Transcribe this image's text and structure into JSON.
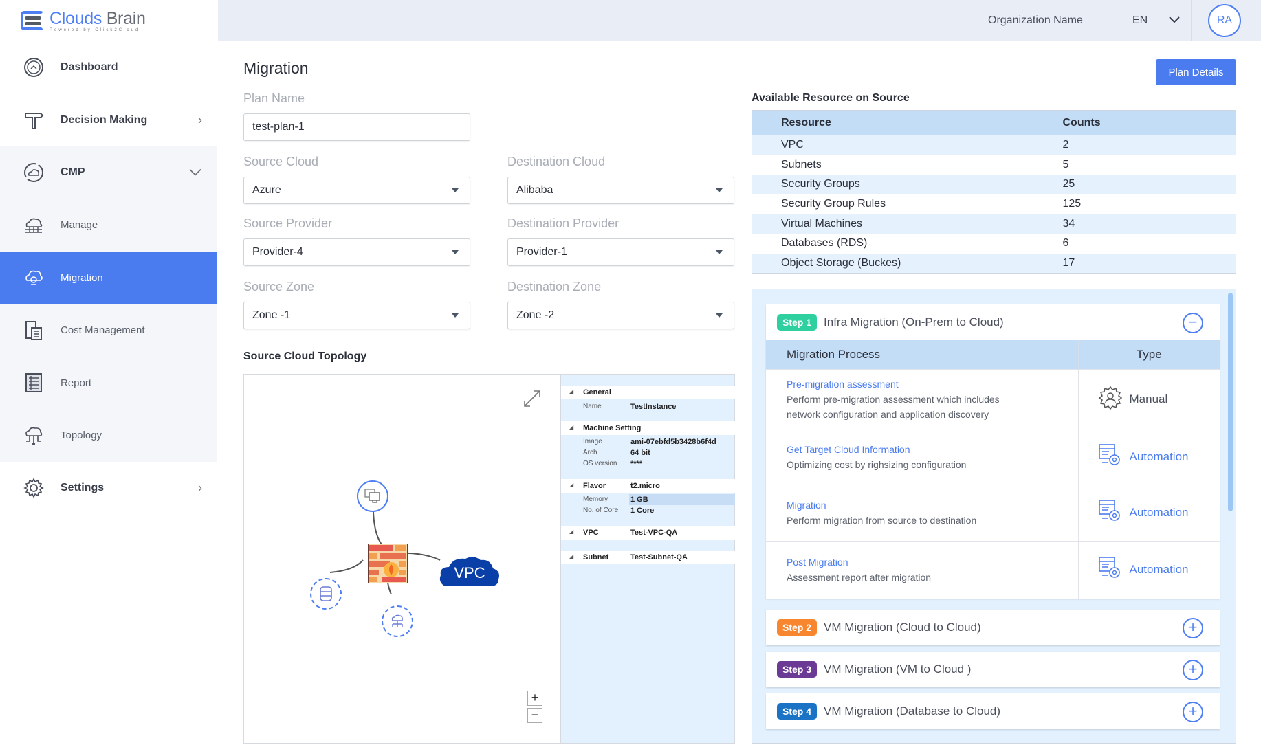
{
  "app": {
    "logo_primary": "Clouds",
    "logo_secondary": "Brain",
    "logo_tagline": "Powered by Click2Cloud"
  },
  "sidebar": {
    "items": [
      {
        "label": "Dashboard",
        "icon": "dashboard-icon"
      },
      {
        "label": "Decision Making",
        "icon": "signpost-icon",
        "chevron": "›"
      },
      {
        "label": "CMP",
        "icon": "cloud-cycle-icon",
        "chevron": "⌄"
      },
      {
        "label": "Manage",
        "icon": "cloud-network-icon"
      },
      {
        "label": "Migration",
        "icon": "cloud-migration-icon"
      },
      {
        "label": "Cost Management",
        "icon": "cost-document-icon"
      },
      {
        "label": "Report",
        "icon": "report-icon"
      },
      {
        "label": "Topology",
        "icon": "topology-icon"
      },
      {
        "label": "Settings",
        "icon": "gear-icon",
        "chevron": "›"
      }
    ]
  },
  "topbar": {
    "organization": "Organization Name",
    "language": "EN",
    "avatar_initials": "RA"
  },
  "main": {
    "title": "Migration",
    "plan_details_button": "Plan Details",
    "form": {
      "plan_name_label": "Plan Name",
      "plan_name_value": "test-plan-1",
      "source_cloud_label": "Source Cloud",
      "source_cloud_value": "Azure",
      "destination_cloud_label": "Destination Cloud",
      "destination_cloud_value": "Alibaba",
      "source_provider_label": "Source Provider",
      "source_provider_value": "Provider-4",
      "destination_provider_label": "Destination Provider",
      "destination_provider_value": "Provider-1",
      "source_zone_label": "Source Zone",
      "source_zone_value": "Zone -1",
      "destination_zone_label": "Destination Zone",
      "destination_zone_value": "Zone -2"
    },
    "topology": {
      "title": "Source Cloud Topology",
      "vpc_label": "VPC",
      "zoom_in": "+",
      "zoom_out": "−",
      "properties": {
        "general_label": "General",
        "name_key": "Name",
        "name_value": "TestInstance",
        "machine_label": "Machine Setting",
        "image_key": "Image",
        "image_value": "ami-07ebfd5b3428b6f4d",
        "arch_key": "Arch",
        "arch_value": "64 bit",
        "os_key": "OS version",
        "os_value": "****",
        "flavor_label": "Flavor",
        "flavor_value": "t2.micro",
        "memory_key": "Memory",
        "memory_value": "1 GB",
        "cores_key": "No. of Core",
        "cores_value": "1 Core",
        "vpc_label": "VPC",
        "vpc_value": "Test-VPC-QA",
        "subnet_label": "Subnet",
        "subnet_value": "Test-Subnet-QA"
      }
    },
    "resources": {
      "title": "Available Resource on Source",
      "headers": [
        "Resource",
        "Counts"
      ],
      "rows": [
        {
          "name": "VPC",
          "count": "2"
        },
        {
          "name": "Subnets",
          "count": "5"
        },
        {
          "name": "Security Groups",
          "count": "25"
        },
        {
          "name": "Security Group Rules",
          "count": "125"
        },
        {
          "name": "Virtual  Machines",
          "count": "34"
        },
        {
          "name": "Databases (RDS)",
          "count": "6"
        },
        {
          "name": "Object Storage (Buckes)",
          "count": "17"
        }
      ]
    },
    "steps": [
      {
        "badge": "Step 1",
        "title": "Infra Migration (On-Prem to Cloud)",
        "color": "#2ed0a0",
        "expanded": true,
        "toggle": "−",
        "headers": [
          "Migration Process",
          "Type"
        ],
        "processes": [
          {
            "name": "Pre-migration assessment",
            "desc_line1": "Perform pre-migration assessment which includes",
            "desc_line2": "network configuration and application discovery",
            "type": "Manual"
          },
          {
            "name": "Get Target Cloud Information",
            "desc_line1": "Optimizing cost by righsizing configuration",
            "type": "Automation"
          },
          {
            "name": "Migration",
            "desc_line1": "Perform migration from source to destination",
            "type": "Automation"
          },
          {
            "name": "Post Migration",
            "desc_line1": "Assessment report after migration",
            "type": "Automation"
          }
        ]
      },
      {
        "badge": "Step 2",
        "title": "VM Migration (Cloud to Cloud)",
        "color": "#f7862f",
        "expanded": false,
        "toggle": "+"
      },
      {
        "badge": "Step 3",
        "title": "VM Migration (VM to Cloud )",
        "color": "#6b3a94",
        "expanded": false,
        "toggle": "+"
      },
      {
        "badge": "Step 4",
        "title": "VM Migration (Database to Cloud)",
        "color": "#1a73c4",
        "expanded": false,
        "toggle": "+"
      }
    ]
  },
  "colors": {
    "accent": "#4a7cf0",
    "table_header": "#c4ddf7",
    "panel_bg": "#e3f0fd"
  }
}
